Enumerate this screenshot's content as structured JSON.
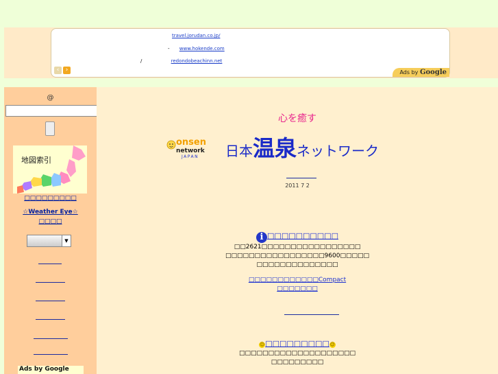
{
  "ad_banner": {
    "lines": [
      {
        "prefix": "",
        "url": "travel.jorudan.co.jp/"
      },
      {
        "prefix": "-",
        "url": "www.hokende.com"
      },
      {
        "prefix": "/",
        "url": "redondobeachinn.net"
      }
    ],
    "ads_by": "Ads by",
    "google": "Google",
    "prev_label": "‹",
    "next_label": "›"
  },
  "sidebar": {
    "at_symbol": "@",
    "search": {
      "value": "",
      "placeholder": ""
    },
    "map_title": "地図索引",
    "map_link": "□□□□□□□□□",
    "weather": {
      "label": "☆Weather Eye☆",
      "sub": "□□□□"
    },
    "select": {
      "value": ""
    },
    "ads_label": "Ads by Google"
  },
  "main": {
    "tagline": "心を癒す",
    "logo": {
      "onsen_text": "onsen",
      "network_text": "network",
      "japan_text": "JAPAN",
      "title_prefix": "日本",
      "title_big": "温泉",
      "title_suffix": "ネットワーク"
    },
    "date": "2011 7 2",
    "info": {
      "icon": "i",
      "head": "□□□□□□□□□□",
      "line1": "□□2621□□□□□□□□□□□□□□□□□",
      "line2": "□□□□□□□□□□□□□□□□□9600□□□□□",
      "line3": "□□□□□□□□□□□□□□",
      "compact_link": "□□□□□□□□□□□□Compact",
      "compact_link2": "□□□□□□□"
    },
    "section2": {
      "head": "□□□□□□□□□",
      "line1": "□□□□□□□□□□□□□□□□□□□□",
      "line2": "□□□□□□□□□"
    }
  },
  "colors": {
    "background": "#f0ffd9",
    "sidebar": "#ffce9c",
    "main": "#fff0cf",
    "accent_pink": "#e8248c",
    "title_blue": "#1a2ac8",
    "link_blue": "#001fa0"
  }
}
